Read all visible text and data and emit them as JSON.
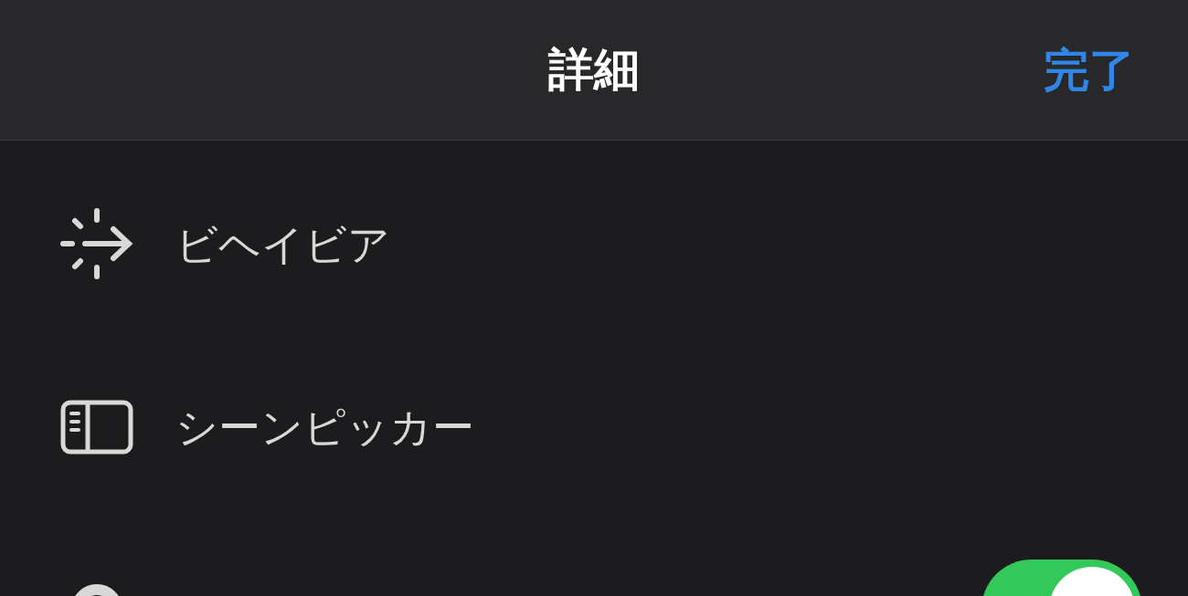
{
  "header": {
    "title": "詳細",
    "done": "完了"
  },
  "rows": [
    {
      "kind": "behavior",
      "label": "ビヘイビア"
    },
    {
      "kind": "scene",
      "label": "シーンピッカー"
    },
    {
      "kind": "toggle",
      "on": true
    }
  ]
}
